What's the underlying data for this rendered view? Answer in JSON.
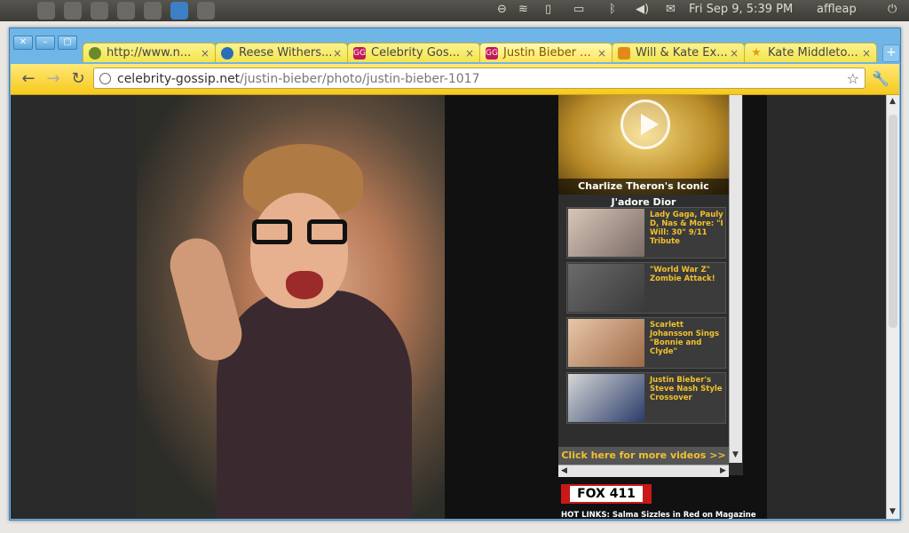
{
  "panel": {
    "clock": "Fri Sep  9,  5:39 PM",
    "user": "affleap"
  },
  "browser": {
    "tabs": [
      {
        "label": "http://www.n...",
        "icon": "globe-icon",
        "color": "#6a8a2a"
      },
      {
        "label": "Reese Withers...",
        "icon": "site-icon",
        "color": "#2a6fb5"
      },
      {
        "label": "Celebrity Gos...",
        "icon": "gg-icon",
        "color": "#c2185b"
      },
      {
        "label": "Justin Bieber ...",
        "icon": "gg-icon",
        "color": "#c2185b",
        "active": true
      },
      {
        "label": "Will & Kate Ex...",
        "icon": "site-icon",
        "color": "#e08a1a"
      },
      {
        "label": "Kate Middleto...",
        "icon": "star-icon",
        "color": "#e0a010"
      }
    ],
    "favicon_text": "GG",
    "address": {
      "domain": "celebrity-gossip.net",
      "path": "/justin-bieber/photo/justin-bieber-1017"
    }
  },
  "sidebar": {
    "promo_caption": "Charlize Theron's Iconic J'adore Dior",
    "videos": [
      {
        "title": "Lady Gaga, Pauly D, Nas & More: \"I Will: 30\" 9/11 Tribute"
      },
      {
        "title": "\"World War Z\" Zombie Attack!"
      },
      {
        "title": "Scarlett Johansson Sings \"Bonnie and Clyde\""
      },
      {
        "title": "Justin Bieber's Steve Nash Style Crossover"
      }
    ],
    "more_videos": "Click here for more videos >>"
  },
  "footer": {
    "fox_label": "FOX 411",
    "hot_links": "HOT LINKS: Salma Sizzles in Red on Magazine"
  }
}
